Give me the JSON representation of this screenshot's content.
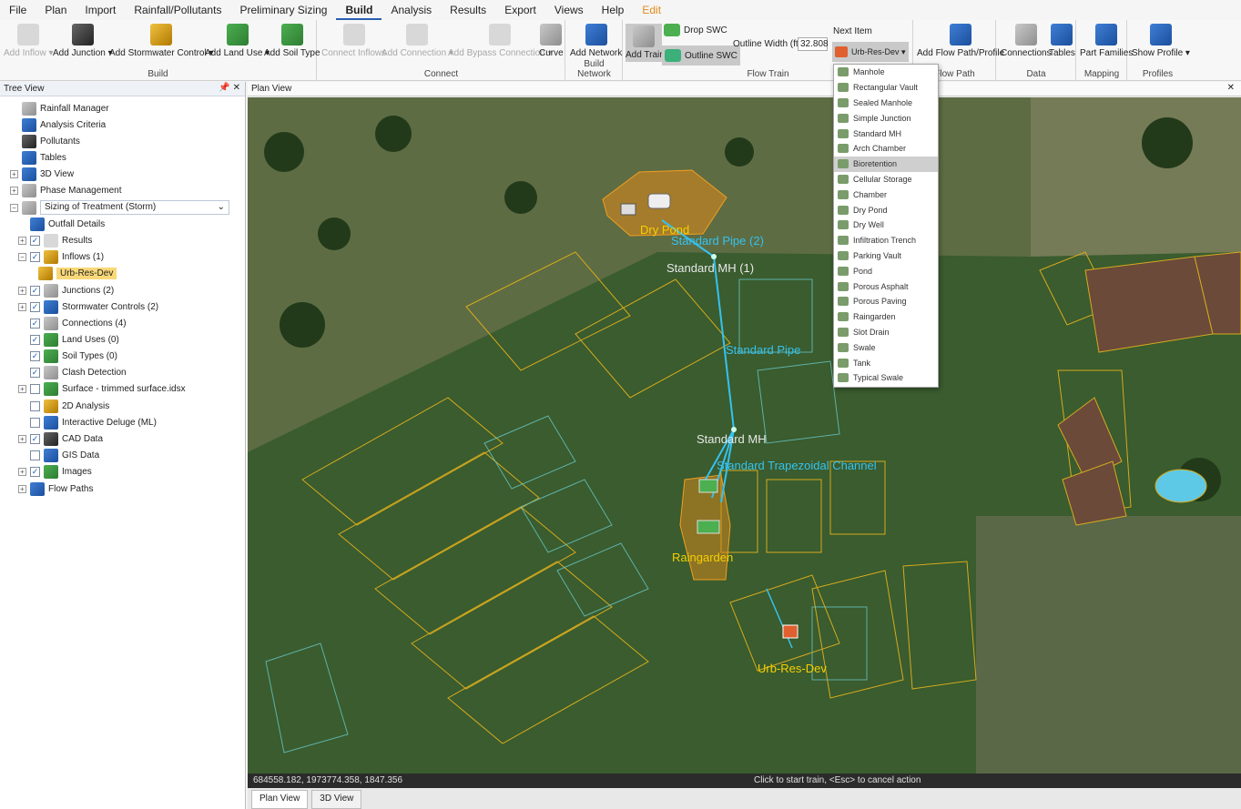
{
  "menu": [
    "File",
    "Plan",
    "Import",
    "Rainfall/Pollutants",
    "Preliminary Sizing",
    "Build",
    "Analysis",
    "Results",
    "Export",
    "Views",
    "Help",
    "Edit"
  ],
  "ribbon": {
    "build": {
      "label": "Build",
      "buttons": [
        "Add Inflow",
        "Add Junction",
        "Add Stormwater Control",
        "Add Land Use",
        "Add Soil Type"
      ]
    },
    "connect": {
      "label": "Connect",
      "buttons": [
        "Connect Inflows",
        "Add Connection",
        "Add Bypass Connection",
        "Curve"
      ]
    },
    "build_network": {
      "label": "Build Network",
      "button": "Add Network"
    },
    "flow_train": {
      "label": "Flow Train",
      "add_train": "Add Train",
      "drop_swc": "Drop SWC",
      "outline_swc": "Outline SWC",
      "outline_width_label": "Outline Width (ft)",
      "outline_width_value": "32.808",
      "next_item_label": "Next Item",
      "next_item_value": "Urb-Res-Dev"
    },
    "flow_path": {
      "label": "Flow Path",
      "button": "Add Flow Path/Profile"
    },
    "data": {
      "label": "Data",
      "buttons": [
        "Connections",
        "Tables"
      ]
    },
    "mapping": {
      "label": "Mapping",
      "button": "Part Families"
    },
    "profiles": {
      "label": "Profiles",
      "button": "Show Profile"
    }
  },
  "tree": {
    "title": "Tree View",
    "items": [
      "Rainfall Manager",
      "Analysis Criteria",
      "Pollutants",
      "Tables",
      "3D View",
      "Phase Management",
      "Sizing of Treatment (Storm)",
      "Outfall Details",
      "Results",
      "Inflows (1)",
      "Urb-Res-Dev",
      "Junctions (2)",
      "Stormwater Controls (2)",
      "Connections (4)",
      "Land Uses (0)",
      "Soil Types (0)",
      "Clash Detection",
      "Surface - trimmed surface.idsx",
      "2D Analysis",
      "Interactive Deluge (ML)",
      "CAD Data",
      "GIS Data",
      "Images",
      "Flow Paths"
    ]
  },
  "plan": {
    "title": "Plan View",
    "labels": {
      "dry_pond": "Dry Pond",
      "pipe2": "Standard Pipe (2)",
      "mh1": "Standard MH (1)",
      "pipe": "Standard Pipe",
      "mh": "Standard MH",
      "channel": "Standard Trapezoidal Channel",
      "raingarden": "Raingarden",
      "urb": "Urb-Res-Dev"
    }
  },
  "status": {
    "coords": "684558.182, 1973774.358, 1847.356",
    "hint": "Click to start train, <Esc> to cancel action"
  },
  "tabs": [
    "Plan View",
    "3D View"
  ],
  "dropdown": {
    "items": [
      "Manhole",
      "Rectangular Vault",
      "Sealed Manhole",
      "Simple Junction",
      "Standard MH",
      "Arch Chamber",
      "Bioretention",
      "Cellular Storage",
      "Chamber",
      "Dry Pond",
      "Dry Well",
      "Infiltration Trench",
      "Parking Vault",
      "Pond",
      "Porous Asphalt",
      "Porous Paving",
      "Raingarden",
      "Slot Drain",
      "Swale",
      "Tank",
      "Typical Swale"
    ],
    "highlighted": "Bioretention"
  },
  "colors": {
    "accent": "#2a5fb0",
    "edit_menu": "#e08a1a",
    "label_yellow": "#f5d000",
    "label_cyan": "#35c2f0",
    "selected": "#f8d878"
  }
}
